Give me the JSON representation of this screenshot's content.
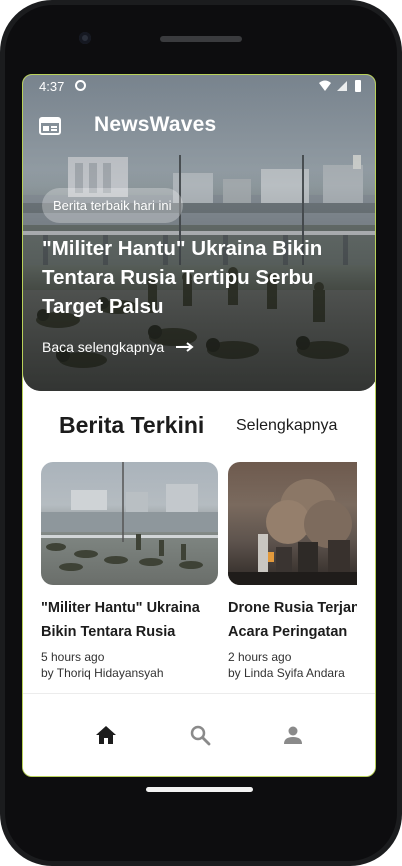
{
  "status_bar": {
    "time": "4:37"
  },
  "app": {
    "title": "NewsWaves"
  },
  "hero": {
    "chip": "Berita terbaik hari ini",
    "headline": "\"Militer Hantu\" Ukraina Bikin Tentara Rusia Tertipu Serbu Target Palsu",
    "link": "Baca selengkapnya"
  },
  "section": {
    "title": "Berita Terkini",
    "see_more": "Selengkapnya"
  },
  "cards": [
    {
      "title": "\"Militer Hantu\" Ukraina",
      "title_line2": "Bikin Tentara Rusia",
      "time": "5 hours ago",
      "author": "by Thoriq Hidayansyah"
    },
    {
      "title": "Drone Rusia Terjang",
      "title_line2": "Acara Peringatan",
      "time": "2 hours ago",
      "author": "by Linda Syifa Andara"
    }
  ],
  "nav": {
    "items": [
      "home-icon",
      "search-icon",
      "person-icon"
    ]
  },
  "colors": {
    "accent": "#1c1c1c",
    "inactive": "#8a8a8a"
  }
}
